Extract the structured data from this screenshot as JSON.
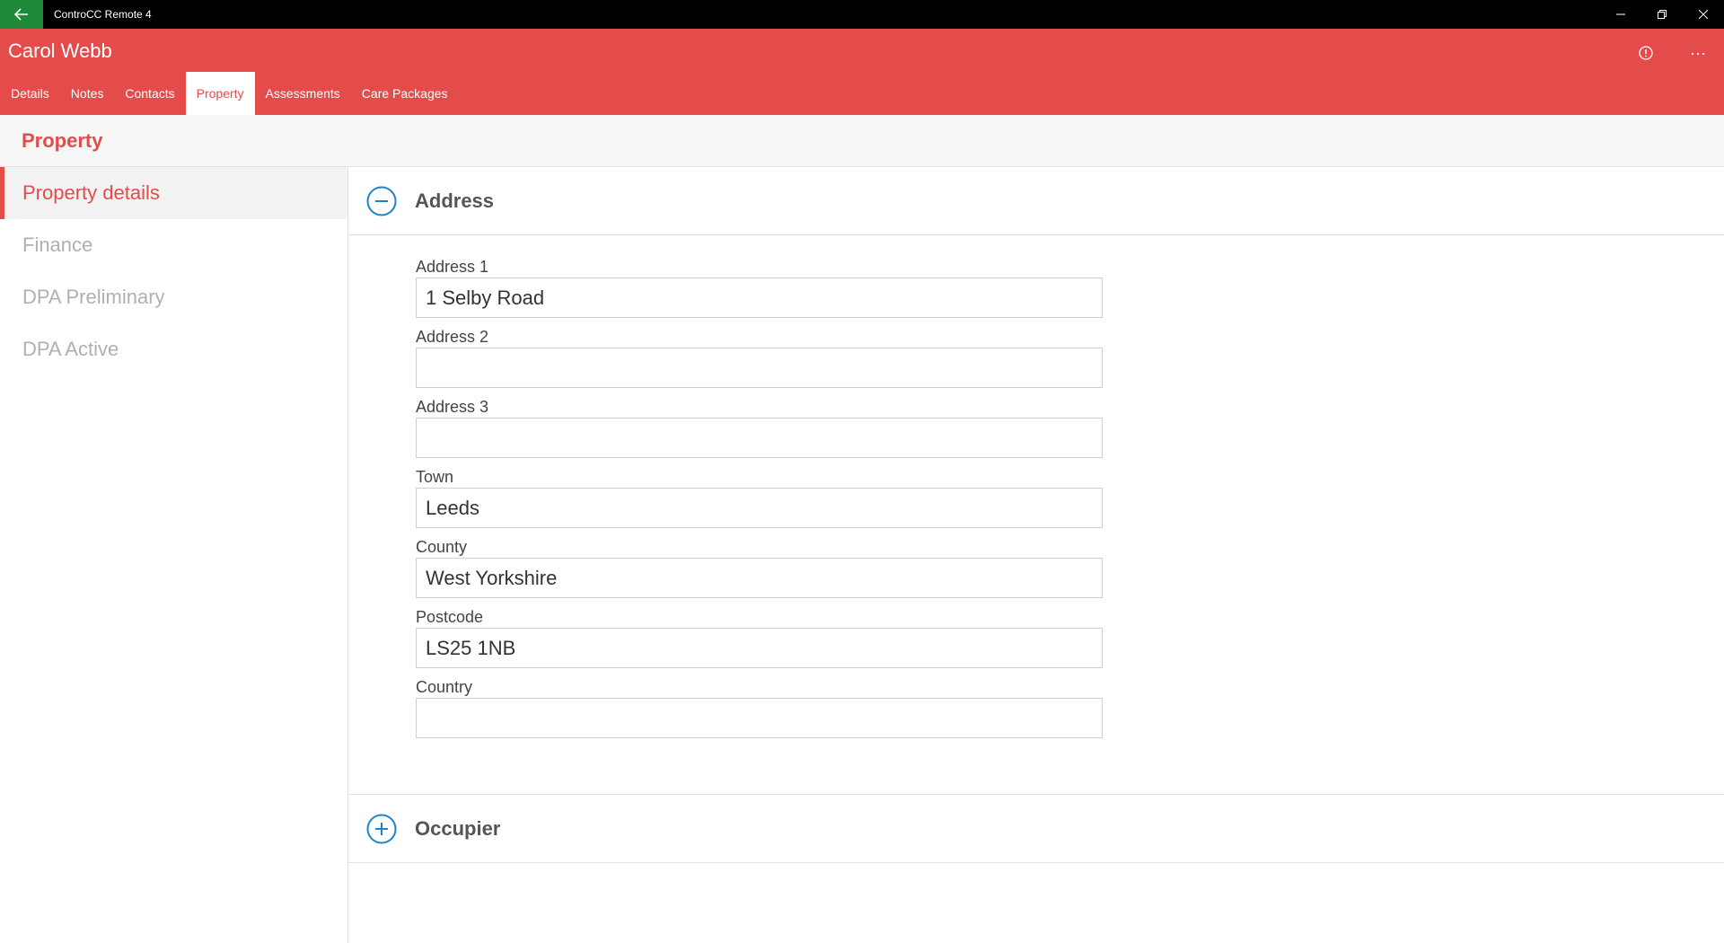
{
  "app": {
    "title": "ControCC Remote 4"
  },
  "window_controls": {
    "minimize": "—",
    "restore": "❐",
    "close": "✕"
  },
  "header": {
    "client_name": "Carol Webb",
    "tabs": [
      {
        "label": "Details"
      },
      {
        "label": "Notes"
      },
      {
        "label": "Contacts"
      },
      {
        "label": "Property",
        "active": true
      },
      {
        "label": "Assessments"
      },
      {
        "label": "Care Packages"
      }
    ],
    "more_label": "···"
  },
  "page": {
    "title": "Property"
  },
  "sidenav": {
    "items": [
      {
        "label": "Property details",
        "active": true
      },
      {
        "label": "Finance"
      },
      {
        "label": "DPA Preliminary"
      },
      {
        "label": "DPA Active"
      }
    ]
  },
  "address_section": {
    "title": "Address",
    "expanded": true,
    "fields": {
      "address1": {
        "label": "Address 1",
        "value": "1 Selby Road"
      },
      "address2": {
        "label": "Address 2",
        "value": ""
      },
      "address3": {
        "label": "Address 3",
        "value": ""
      },
      "town": {
        "label": "Town",
        "value": "Leeds"
      },
      "county": {
        "label": "County",
        "value": "West Yorkshire"
      },
      "postcode": {
        "label": "Postcode",
        "value": "LS25 1NB"
      },
      "country": {
        "label": "Country",
        "value": ""
      }
    }
  },
  "occupier_section": {
    "title": "Occupier",
    "expanded": false
  },
  "colors": {
    "accent": "#e44b4b",
    "back_button": "#1e8a3a",
    "section_icon": "#1a86c8",
    "titlebar": "#000000"
  }
}
